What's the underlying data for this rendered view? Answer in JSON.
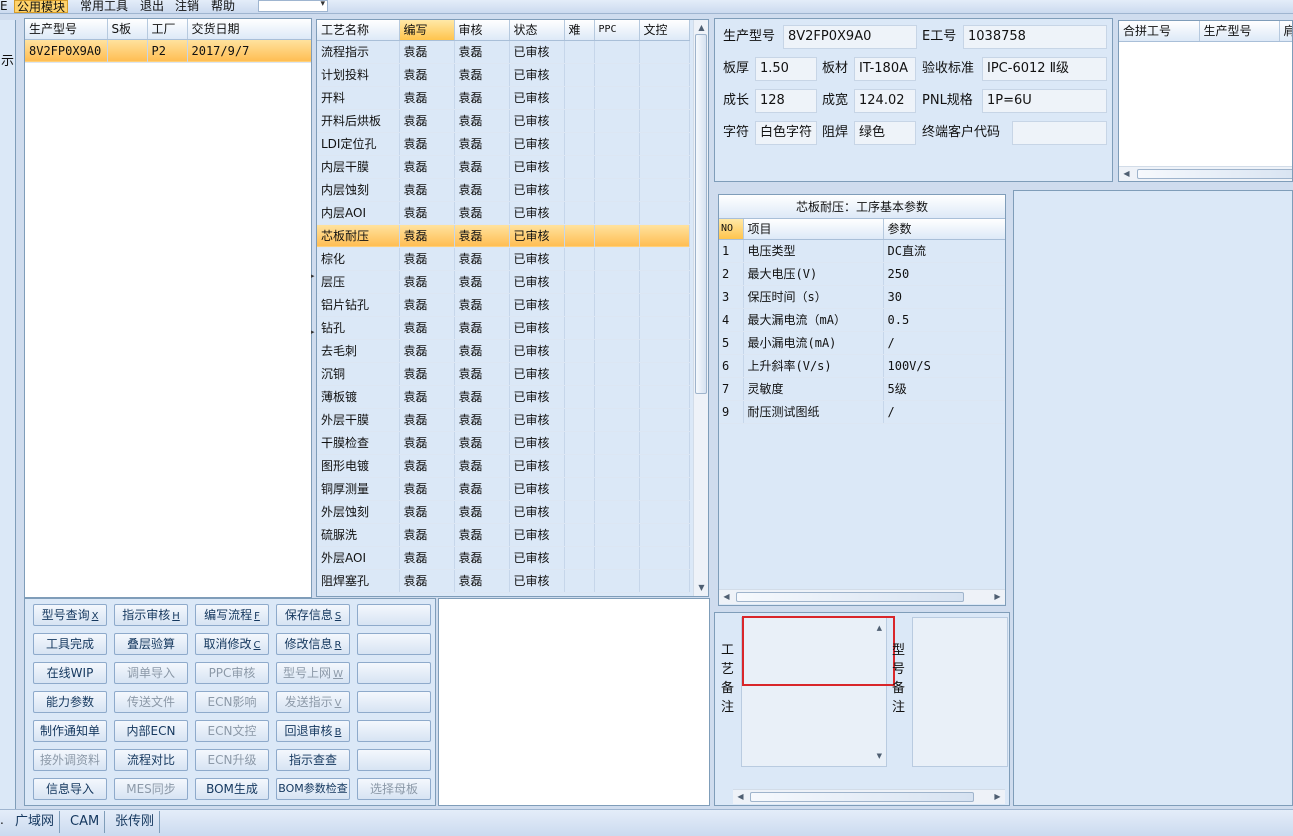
{
  "menu": {
    "items": [
      "公用模块",
      "常用工具",
      "退出",
      "注销",
      "帮助"
    ],
    "active_index": 0,
    "left_fragment": "E"
  },
  "left_strip_text": "示",
  "order_grid": {
    "headers": [
      "生产型号",
      "S板",
      "工厂",
      "交货日期"
    ],
    "rows": [
      [
        "8V2FP0X9A0",
        "",
        "P2",
        "2017/9/7"
      ]
    ],
    "selected_row": 0
  },
  "process_grid": {
    "headers": [
      "工艺名称",
      "编写",
      "审核",
      "状态",
      "难",
      "PPC",
      "文控"
    ],
    "highlight_header": 1,
    "selected_row": 8,
    "rows": [
      [
        "流程指示",
        "袁磊",
        "袁磊",
        "已审核"
      ],
      [
        "计划投料",
        "袁磊",
        "袁磊",
        "已审核"
      ],
      [
        "开料",
        "袁磊",
        "袁磊",
        "已审核"
      ],
      [
        "开料后烘板",
        "袁磊",
        "袁磊",
        "已审核"
      ],
      [
        "LDI定位孔",
        "袁磊",
        "袁磊",
        "已审核"
      ],
      [
        "内层干膜",
        "袁磊",
        "袁磊",
        "已审核"
      ],
      [
        "内层蚀刻",
        "袁磊",
        "袁磊",
        "已审核"
      ],
      [
        "内层AOI",
        "袁磊",
        "袁磊",
        "已审核"
      ],
      [
        "芯板耐压",
        "袁磊",
        "袁磊",
        "已审核"
      ],
      [
        "棕化",
        "袁磊",
        "袁磊",
        "已审核"
      ],
      [
        "层压",
        "袁磊",
        "袁磊",
        "已审核"
      ],
      [
        "铝片钻孔",
        "袁磊",
        "袁磊",
        "已审核"
      ],
      [
        "钻孔",
        "袁磊",
        "袁磊",
        "已审核"
      ],
      [
        "去毛刺",
        "袁磊",
        "袁磊",
        "已审核"
      ],
      [
        "沉铜",
        "袁磊",
        "袁磊",
        "已审核"
      ],
      [
        "薄板镀",
        "袁磊",
        "袁磊",
        "已审核"
      ],
      [
        "外层干膜",
        "袁磊",
        "袁磊",
        "已审核"
      ],
      [
        "干膜检查",
        "袁磊",
        "袁磊",
        "已审核"
      ],
      [
        "图形电镀",
        "袁磊",
        "袁磊",
        "已审核"
      ],
      [
        "铜厚测量",
        "袁磊",
        "袁磊",
        "已审核"
      ],
      [
        "外层蚀刻",
        "袁磊",
        "袁磊",
        "已审核"
      ],
      [
        "硫脲洗",
        "袁磊",
        "袁磊",
        "已审核"
      ],
      [
        "外层AOI",
        "袁磊",
        "袁磊",
        "已审核"
      ],
      [
        "阻焊塞孔",
        "袁磊",
        "袁磊",
        "已审核"
      ]
    ]
  },
  "info": {
    "model_label": "生产型号",
    "model_value": "8V2FP0X9A0",
    "e_label": "E工号",
    "e_value": "1038758",
    "thickness_label": "板厚",
    "thickness_value": "1.50",
    "material_label": "板材",
    "material_value": "IT-180A",
    "standard_label": "验收标准",
    "standard_value": "IPC-6012 Ⅱ级",
    "length_label": "成长",
    "length_value": "128",
    "width_label": "成宽",
    "width_value": "124.02",
    "pnl_label": "PNL规格",
    "pnl_value": "1P=6U",
    "char_label": "字符",
    "char_value": "白色字符",
    "mask_label": "阻焊",
    "mask_value": "绿色",
    "customer_label": "终端客户代码",
    "customer_value": ""
  },
  "merge_grid": {
    "headers": [
      "合拼工号",
      "生产型号",
      "肩"
    ]
  },
  "params": {
    "title": "芯板耐压：工序基本参数",
    "headers": [
      "NO",
      "项目",
      "参数"
    ],
    "rows": [
      [
        "1",
        "电压类型",
        "DC直流"
      ],
      [
        "2",
        "最大电压(V)",
        "250"
      ],
      [
        "3",
        "保压时间（s）",
        "30"
      ],
      [
        "4",
        "最大漏电流（mA）",
        "0.5"
      ],
      [
        "5",
        "最小漏电流(mA)",
        "/"
      ],
      [
        "6",
        "上升斜率(V/s)",
        "100V/S"
      ],
      [
        "7",
        "灵敏度",
        "5级"
      ],
      [
        "9",
        "耐压测试图纸",
        "/"
      ]
    ]
  },
  "remarks": {
    "process_label": "工艺备注",
    "model_label": "型号备注"
  },
  "buttons": [
    [
      {
        "label": "型号查询",
        "key": "X",
        "enabled": true
      },
      {
        "label": "指示审核",
        "key": "H",
        "enabled": true
      },
      {
        "label": "编写流程",
        "key": "F",
        "enabled": true
      },
      {
        "label": "保存信息",
        "key": "S",
        "enabled": true
      },
      {
        "label": "",
        "key": "",
        "enabled": true
      }
    ],
    [
      {
        "label": "工具完成",
        "key": "",
        "enabled": true
      },
      {
        "label": "叠层验算",
        "key": "",
        "enabled": true
      },
      {
        "label": "取消修改",
        "key": "C",
        "enabled": true
      },
      {
        "label": "修改信息",
        "key": "R",
        "enabled": true
      },
      {
        "label": "",
        "key": "",
        "enabled": true
      }
    ],
    [
      {
        "label": "在线WIP",
        "key": "",
        "enabled": true
      },
      {
        "label": "调单导入",
        "key": "",
        "enabled": false
      },
      {
        "label": "PPC审核",
        "key": "",
        "enabled": false
      },
      {
        "label": "型号上网",
        "key": "W",
        "enabled": false
      },
      {
        "label": "",
        "key": "",
        "enabled": true
      }
    ],
    [
      {
        "label": "能力参数",
        "key": "",
        "enabled": true
      },
      {
        "label": "传送文件",
        "key": "",
        "enabled": false
      },
      {
        "label": "ECN影响",
        "key": "",
        "enabled": false
      },
      {
        "label": "发送指示",
        "key": "V",
        "enabled": false
      },
      {
        "label": "",
        "key": "",
        "enabled": true
      }
    ],
    [
      {
        "label": "制作通知单",
        "key": "",
        "enabled": true
      },
      {
        "label": "内部ECN",
        "key": "",
        "enabled": true
      },
      {
        "label": "ECN文控",
        "key": "",
        "enabled": false
      },
      {
        "label": "回退审核",
        "key": "B",
        "enabled": true
      },
      {
        "label": "",
        "key": "",
        "enabled": true
      }
    ],
    [
      {
        "label": "接外调资料",
        "key": "",
        "enabled": false
      },
      {
        "label": "流程对比",
        "key": "",
        "enabled": true
      },
      {
        "label": "ECN升级",
        "key": "",
        "enabled": false
      },
      {
        "label": "指示查查",
        "key": "",
        "enabled": true
      },
      {
        "label": "",
        "key": "",
        "enabled": true
      }
    ],
    [
      {
        "label": "信息导入",
        "key": "",
        "enabled": true
      },
      {
        "label": "MES同步",
        "key": "",
        "enabled": false
      },
      {
        "label": "BOM生成",
        "key": "",
        "enabled": true
      },
      {
        "label": "BOM参数检查",
        "key": "",
        "enabled": true
      },
      {
        "label": "选择母板",
        "key": "",
        "enabled": false
      }
    ]
  ],
  "status_bar": [
    "广域网",
    "CAM",
    "张传刚"
  ],
  "colors": {
    "selection": "#ffc44d",
    "panel": "#dbe8f7",
    "highlight_box": "#d9262a"
  }
}
